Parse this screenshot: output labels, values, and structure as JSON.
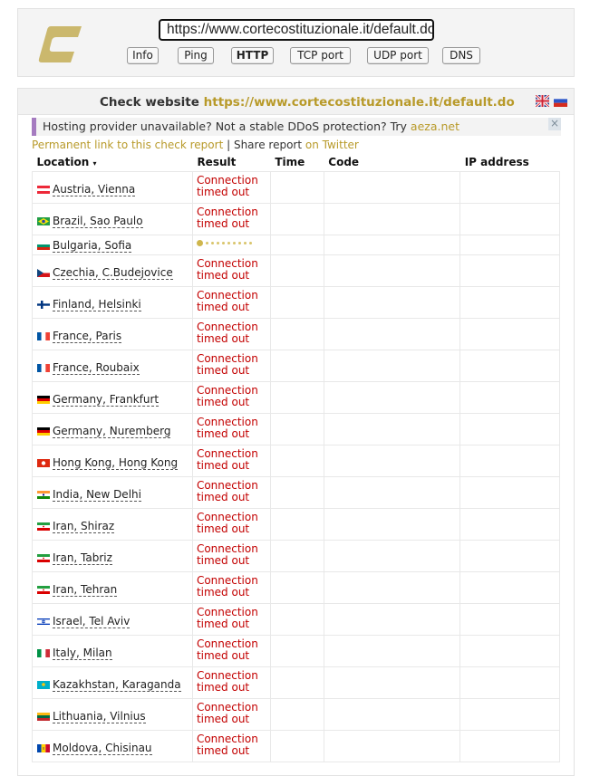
{
  "url_value": "https://www.cortecostituzionale.it/default.do",
  "modes": [
    "Info",
    "Ping",
    "HTTP",
    "TCP port",
    "UDP port",
    "DNS"
  ],
  "active_mode": "HTTP",
  "panel": {
    "title_prefix": "Check website",
    "title_url": "https://www.cortecostituzionale.it/default.do"
  },
  "ad": {
    "text": "Hosting provider unavailable? Not a stable DDoS protection? Try ",
    "link": "aeza.net",
    "close": "×"
  },
  "links": {
    "permanent": "Permanent link to this check report",
    "sep": " | ",
    "share": "Share report",
    "twitter": " on Twitter"
  },
  "columns": {
    "location": "Location",
    "sort_marker": "▾",
    "result": "Result",
    "time": "Time",
    "code": "Code",
    "ip": "IP address"
  },
  "rows": [
    {
      "flag": "at",
      "location": "Austria, Vienna",
      "result": [
        "Connection",
        "timed out"
      ]
    },
    {
      "flag": "br",
      "location": "Brazil, Sao Paulo",
      "result": [
        "Connection",
        "timed out"
      ]
    },
    {
      "flag": "bg",
      "location": "Bulgaria, Sofia",
      "result": null
    },
    {
      "flag": "cz",
      "location": "Czechia, C.Budejovice",
      "result": [
        "Connection",
        "timed out"
      ]
    },
    {
      "flag": "fi",
      "location": "Finland, Helsinki",
      "result": [
        "Connection",
        "timed out"
      ]
    },
    {
      "flag": "fr",
      "location": "France, Paris",
      "result": [
        "Connection",
        "timed out"
      ]
    },
    {
      "flag": "fr",
      "location": "France, Roubaix",
      "result": [
        "Connection",
        "timed out"
      ]
    },
    {
      "flag": "de",
      "location": "Germany, Frankfurt",
      "result": [
        "Connection",
        "timed out"
      ]
    },
    {
      "flag": "de",
      "location": "Germany, Nuremberg",
      "result": [
        "Connection",
        "timed out"
      ]
    },
    {
      "flag": "hk",
      "location": "Hong Kong, Hong Kong",
      "result": [
        "Connection",
        "timed out"
      ]
    },
    {
      "flag": "in",
      "location": "India, New Delhi",
      "result": [
        "Connection",
        "timed out"
      ]
    },
    {
      "flag": "ir",
      "location": "Iran, Shiraz",
      "result": [
        "Connection",
        "timed out"
      ]
    },
    {
      "flag": "ir",
      "location": "Iran, Tabriz",
      "result": [
        "Connection",
        "timed out"
      ]
    },
    {
      "flag": "ir",
      "location": "Iran, Tehran",
      "result": [
        "Connection",
        "timed out"
      ]
    },
    {
      "flag": "il",
      "location": "Israel, Tel Aviv",
      "result": [
        "Connection",
        "timed out"
      ]
    },
    {
      "flag": "it",
      "location": "Italy, Milan",
      "result": [
        "Connection",
        "timed out"
      ]
    },
    {
      "flag": "kz",
      "location": "Kazakhstan, Karaganda",
      "result": [
        "Connection",
        "timed out"
      ]
    },
    {
      "flag": "lt",
      "location": "Lithuania, Vilnius",
      "result": [
        "Connection",
        "timed out"
      ]
    },
    {
      "flag": "md",
      "location": "Moldova, Chisinau",
      "result": [
        "Connection",
        "timed out"
      ]
    }
  ],
  "colors": {
    "accent": "#b89a2a",
    "error": "#c30000",
    "ad_bar": "#a57bc0"
  }
}
